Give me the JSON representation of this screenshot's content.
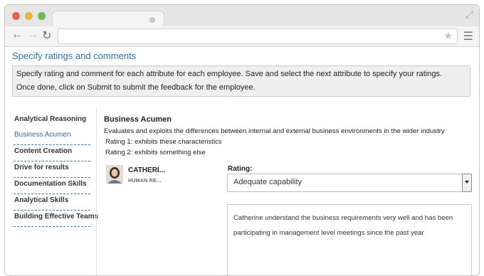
{
  "browser": {
    "url": "",
    "back_icon": "←",
    "forward_icon": "→",
    "reload_icon": "↻",
    "star_icon": "★",
    "menu_icon": "☰",
    "expand_icon": "⤢"
  },
  "page": {
    "heading": "Specify ratings and comments",
    "instructions_line1": "Specify rating and comment for each attribute for each employee. Save and select the next attribute to specify your ratings.",
    "instructions_line2": "Once done, click on Submit to submit the feedback for the employee."
  },
  "sidebar": {
    "items": [
      {
        "label": "Analytical Reasoning"
      },
      {
        "label": "Business Acumen"
      },
      {
        "label": "Content Creation"
      },
      {
        "label": "Drive for results"
      },
      {
        "label": "Documentation Skills"
      },
      {
        "label": "Analytical Skills"
      },
      {
        "label": "Building Effective Teams"
      }
    ]
  },
  "attribute": {
    "title": "Business Acumen",
    "description": "Evaluates and exploits the differences between internal and external business environments in the wider industry",
    "rating1": "Rating 1: exhibits these characteristics",
    "rating2": "Rating 2: exhibits something else"
  },
  "employee": {
    "name": "CATHERI...",
    "department": "HUMAN RE..."
  },
  "rating": {
    "label": "Rating:",
    "selected": "Adequate capability"
  },
  "comment": {
    "text": "Catherine understand the business requirements very well and has been participating in management level meetings since the past year"
  },
  "colors": {
    "accent": "#2e6fa7",
    "close": "#ec5f57",
    "minimize": "#e0b83b",
    "maximize": "#66be57"
  }
}
